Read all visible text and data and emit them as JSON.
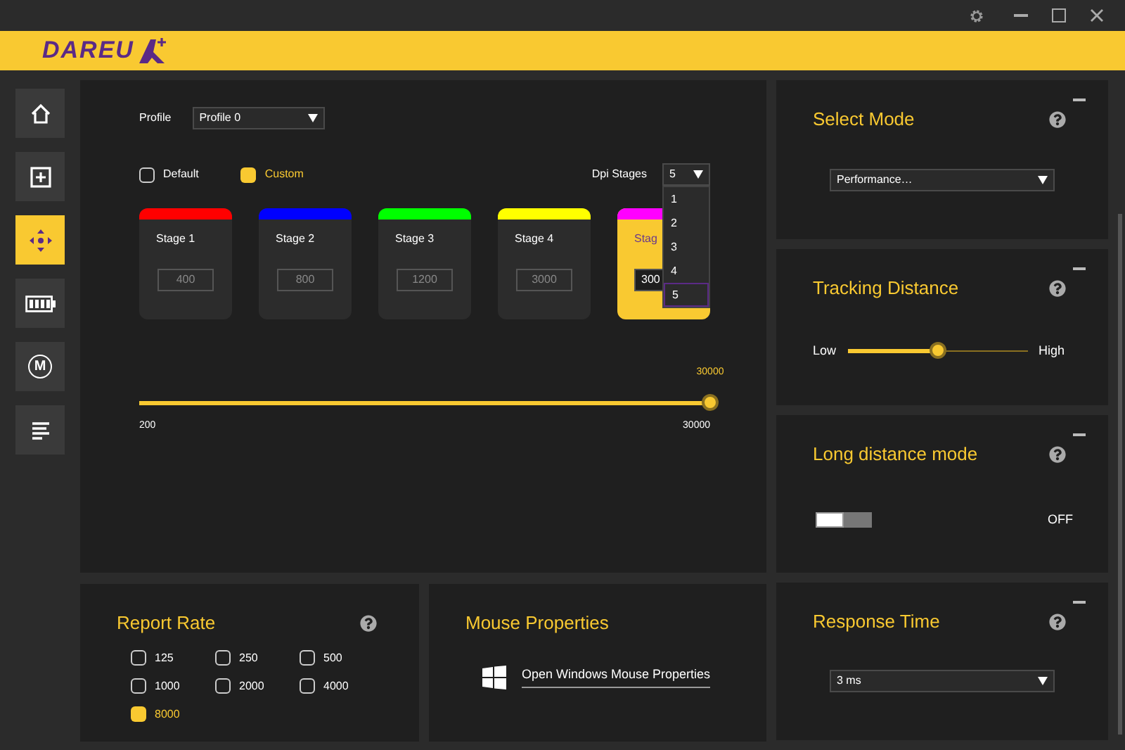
{
  "logo": {
    "text": "DAREU"
  },
  "sidebar": [
    {
      "kind": "home",
      "selected": false
    },
    {
      "kind": "add",
      "selected": false
    },
    {
      "kind": "dpi",
      "selected": true
    },
    {
      "kind": "battery",
      "selected": false
    },
    {
      "kind": "macro",
      "label": "M",
      "selected": false
    },
    {
      "kind": "log",
      "selected": false
    }
  ],
  "dpi_panel": {
    "profile_label": "Profile",
    "profile_value": "Profile 0",
    "modes": [
      {
        "label": "Default",
        "selected": false
      },
      {
        "label": "Custom",
        "selected": true
      }
    ],
    "stages_label": "Dpi Stages",
    "stages_value": "5",
    "stages_options": [
      {
        "label": "1",
        "selected": false
      },
      {
        "label": "2",
        "selected": false
      },
      {
        "label": "3",
        "selected": false
      },
      {
        "label": "4",
        "selected": false
      },
      {
        "label": "5",
        "selected": true
      }
    ],
    "stages": [
      {
        "label": "Stage 1",
        "value": "400",
        "color": "#ff0000",
        "selected": false
      },
      {
        "label": "Stage 2",
        "value": "800",
        "color": "#0000ff",
        "selected": false
      },
      {
        "label": "Stage 3",
        "value": "1200",
        "color": "#00ff00",
        "selected": false
      },
      {
        "label": "Stage 4",
        "value": "3000",
        "color": "#ffff00",
        "selected": false
      },
      {
        "label": "Stag",
        "value": "300",
        "color": "#ff00ff",
        "selected": true
      }
    ],
    "slider": {
      "reading": "30000",
      "level": 1,
      "min_label": "200",
      "max_label": "30000"
    }
  },
  "report_rate": {
    "title": "Report Rate",
    "options": [
      {
        "label": "125",
        "selected": false
      },
      {
        "label": "250",
        "selected": false
      },
      {
        "label": "500",
        "selected": false
      },
      {
        "label": "1000",
        "selected": false
      },
      {
        "label": "2000",
        "selected": false
      },
      {
        "label": "4000",
        "selected": false
      },
      {
        "label": "8000",
        "selected": true
      }
    ]
  },
  "mouse_properties": {
    "title": "Mouse Properties",
    "link": "Open Windows Mouse Properties"
  },
  "select_mode": {
    "title": "Select Mode",
    "value": "Performance…"
  },
  "tracking_distance": {
    "title": "Tracking Distance",
    "low_label": "Low",
    "high_label": "High",
    "level": 0.5
  },
  "long_distance_mode": {
    "title": "Long distance mode",
    "on": false,
    "state_label": "OFF"
  },
  "response_time": {
    "title": "Response Time",
    "value": "3 ms"
  }
}
